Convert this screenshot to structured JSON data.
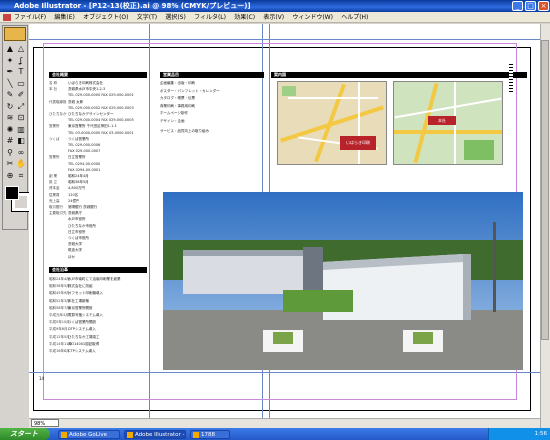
{
  "window": {
    "title": "Adobe Illustrator - [P12-13(校正).ai @ 98% (CMYK/プレビュー)]",
    "buttons": {
      "minimize": "_",
      "maximize": "□",
      "close": "×"
    }
  },
  "menubar": {
    "items": [
      "ファイル(F)",
      "編集(E)",
      "オブジェクト(O)",
      "文字(T)",
      "選択(S)",
      "フィルタ(L)",
      "効果(C)",
      "表示(V)",
      "ウィンドウ(W)",
      "ヘルプ(H)"
    ]
  },
  "toolbox": {
    "tools": [
      "selection-tool",
      "direct-selection-tool",
      "magic-wand-tool",
      "lasso-tool",
      "pen-tool",
      "type-tool",
      "line-tool",
      "rectangle-tool",
      "paintbrush-tool",
      "pencil-tool",
      "rotate-tool",
      "scale-tool",
      "warp-tool",
      "free-transform-tool",
      "symbol-sprayer-tool",
      "graph-tool",
      "mesh-tool",
      "gradient-tool",
      "eyedropper-tool",
      "blend-tool",
      "scissors-tool",
      "hand-tool",
      "zoom-tool",
      "slice-tool"
    ],
    "tool_glyphs": [
      "▲",
      "△",
      "✦",
      "ʆ",
      "✒",
      "T",
      "╲",
      "▭",
      "✎",
      "✐",
      "↻",
      "⤢",
      "≋",
      "⊡",
      "✺",
      "▥",
      "#",
      "◧",
      "⚲",
      "∞",
      "✂",
      "✋",
      "⊕",
      "⌗"
    ]
  },
  "document": {
    "left_page": {
      "section1_header": "会社概要",
      "company_rows": [
        {
          "label": "名 称",
          "value": "いばらき印刷株式会社"
        },
        {
          "label": "本 社",
          "value": "茨城県水戸市中央1-2-3"
        },
        {
          "label": "",
          "value": "TEL 029-000-0000 FAX 029-000-0001"
        },
        {
          "label": "代表取締役",
          "value": "茨城 太郎"
        },
        {
          "label": "",
          "value": "TEL 029-000-0002 FAX 029-000-0003"
        },
        {
          "label": "ひたちなか",
          "value": "ひたちなかデザインセンター"
        },
        {
          "label": "",
          "value": "TEL 029-000-0004 FAX 029-000-0005"
        },
        {
          "label": "営業所",
          "value": "東京営業所 千代田区神田1-1-1"
        },
        {
          "label": "",
          "value": "TEL 03-0000-0000 FAX 03-0000-0001"
        },
        {
          "label": "つくば",
          "value": "つくば営業所"
        },
        {
          "label": "",
          "value": "TEL 029-000-0006"
        },
        {
          "label": "",
          "value": "FAX 029-000-0007"
        },
        {
          "label": "営業所",
          "value": "日立営業所"
        },
        {
          "label": "",
          "value": "TEL 0294-00-0000"
        },
        {
          "label": "",
          "value": "FAX 0294-00-0001"
        },
        {
          "label": "創 業",
          "value": "昭和24年4月"
        },
        {
          "label": "設 立",
          "value": "昭和38年5月"
        },
        {
          "label": "資本金",
          "value": "4,800万円"
        },
        {
          "label": "従業員",
          "value": "120名"
        },
        {
          "label": "売上高",
          "value": "24億円"
        },
        {
          "label": "取引銀行",
          "value": "常陽銀行 茨城銀行"
        },
        {
          "label": "主要取引先",
          "value": "茨城県庁"
        },
        {
          "label": "",
          "value": "水戸市役所"
        },
        {
          "label": "",
          "value": "ひたちなか市役所"
        },
        {
          "label": "",
          "value": "日立市役所"
        },
        {
          "label": "",
          "value": "つくば市役所"
        },
        {
          "label": "",
          "value": "茨城大学"
        },
        {
          "label": "",
          "value": "筑波大学"
        },
        {
          "label": "",
          "value": "ほか"
        }
      ],
      "section2_header": "会社沿革",
      "history_rows": [
        {
          "label": "昭和24年4月",
          "value": "水戸市南町にて活版印刷業を創業"
        },
        {
          "label": "昭和38年5月",
          "value": "株式会社に改組"
        },
        {
          "label": "昭和45年9月",
          "value": "オフセット印刷機導入"
        },
        {
          "label": "昭和52年3月",
          "value": "本社工場新築"
        },
        {
          "label": "昭和58年7月",
          "value": "東京営業所開設"
        },
        {
          "label": "平成元年4月",
          "value": "電算写植システム導入"
        },
        {
          "label": "平成5年10月",
          "value": "つくば営業所開設"
        },
        {
          "label": "平成9年6月",
          "value": "DTPシステム導入"
        },
        {
          "label": "平成12年5月",
          "value": "ひたちなか工場竣工"
        },
        {
          "label": "平成14年11月",
          "value": "ISO14001認証取得"
        },
        {
          "label": "平成16年8月",
          "value": "CTPシステム導入"
        }
      ],
      "page_number": "14"
    },
    "right_page": {
      "section3_header": "営業品目",
      "business_rows": [
        "企画編集・出版・印刷",
        "ポスター・パンフレット・カレンダー",
        "カタログ・帳票・伝票",
        "商業印刷・事務用印刷",
        "ホームページ制作",
        "デザイン・企画"
      ],
      "business_note": "サービス・品質向上の取り組み",
      "section4_header": "案内図",
      "map1_label": "いばらき印刷",
      "map2_label": "本社"
    }
  },
  "statusbar": {
    "zoom": "98%"
  },
  "taskbar": {
    "start_label": "スタート",
    "tasks": [
      "Adobe GoLive",
      "Adobe Illustrator -",
      "1788"
    ],
    "clock": "1:56"
  },
  "colors": {
    "title_bar": "#0a3b9c",
    "guides": "#6a88c9",
    "section_header": "#000000",
    "map_road": "#f3c842"
  }
}
